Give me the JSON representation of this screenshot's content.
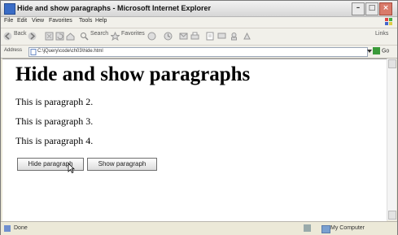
{
  "window": {
    "title": "Hide and show paragraphs - Microsoft Internet Explorer"
  },
  "menu": {
    "items": [
      "File",
      "Edit",
      "View",
      "Favorites",
      "Tools",
      "Help"
    ]
  },
  "toolbar": {
    "back": "Back",
    "search": "Search",
    "favorites": "Favorites",
    "links": "Links"
  },
  "address": {
    "label": "Address",
    "value": "C:\\jQuery\\code\\ch03\\hide.html",
    "go": "Go"
  },
  "page": {
    "heading": "Hide and show paragraphs",
    "paragraphs": [
      "This is paragraph 2.",
      "This is paragraph 3.",
      "This is paragraph 4."
    ],
    "buttons": {
      "hide": "Hide paragraph",
      "show": "Show paragraph"
    }
  },
  "status": {
    "left": "Done",
    "right": "My Computer"
  },
  "icons": [
    "ie-logo-icon",
    "back-icon",
    "forward-icon",
    "stop-icon",
    "refresh-icon",
    "home-icon",
    "search-icon",
    "favorites-icon",
    "media-icon",
    "mail-icon",
    "print-icon",
    "edit-icon",
    "page-icon",
    "computer-icon"
  ],
  "colors": {
    "title_close": "#d97a6a",
    "chrome": "#ece9d8",
    "link": "#000000"
  }
}
